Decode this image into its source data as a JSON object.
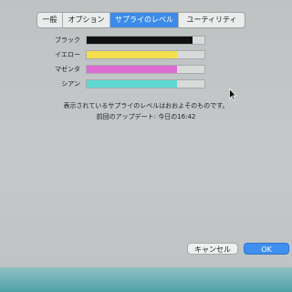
{
  "tabs": [
    {
      "label": "一般",
      "active": false
    },
    {
      "label": "オプション",
      "active": false
    },
    {
      "label": "サプライのレベル",
      "active": true
    },
    {
      "label": "ユーティリティ",
      "active": false
    }
  ],
  "supplies": [
    {
      "label": "ブラック",
      "level": 0.9,
      "color": "#111111"
    },
    {
      "label": "イエロー",
      "level": 0.77,
      "color": "#f2df4a"
    },
    {
      "label": "マゼンタ",
      "level": 0.77,
      "color": "#dc6bd3"
    },
    {
      "label": "シアン",
      "level": 0.77,
      "color": "#5fd8d4"
    }
  ],
  "info": {
    "approx_note": "表示されているサプライのレベルはおおよそのものです。",
    "last_updated": "前回のアップデート: 今日の16:42"
  },
  "buttons": {
    "cancel": "キャンセル",
    "ok": "OK"
  },
  "colors": {
    "accent": "#3d8be8"
  }
}
